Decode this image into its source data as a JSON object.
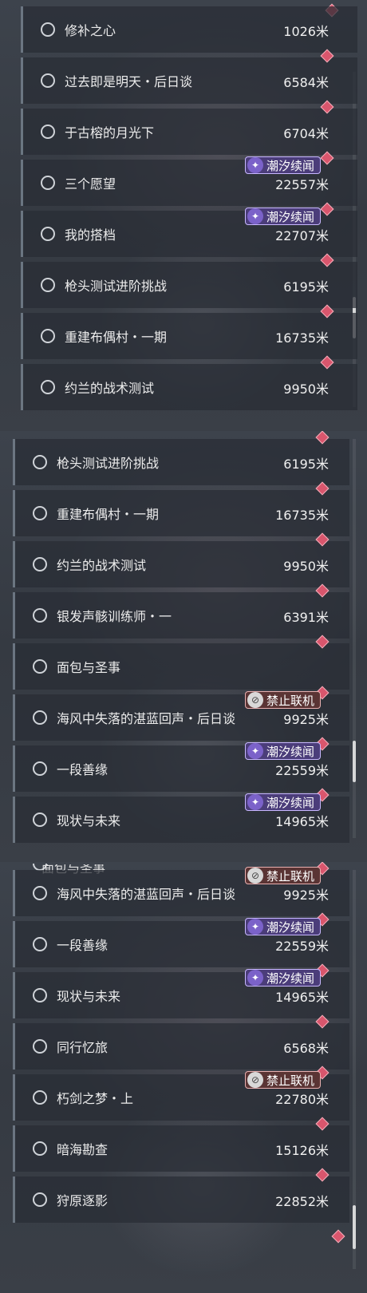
{
  "unit": "米",
  "badges": {
    "tide": {
      "label": "潮汐续闻",
      "icon": "sparkle-icon",
      "color": "#4b3d7a"
    },
    "nolink": {
      "label": "禁止联机",
      "icon": "no-multiplayer-icon",
      "color": "#5a3434"
    }
  },
  "panels": [
    {
      "rows": [
        {
          "title": "修补之心",
          "distance": "1026米",
          "badge": null
        },
        {
          "title": "过去即是明天・后日谈",
          "distance": "6584米",
          "badge": null
        },
        {
          "title": "于古榕的月光下",
          "distance": "6704米",
          "badge": null
        },
        {
          "title": "三个愿望",
          "distance": "22557米",
          "badge": "潮汐续闻"
        },
        {
          "title": "我的搭档",
          "distance": "22707米",
          "badge": "潮汐续闻"
        },
        {
          "title": "枪头测试进阶挑战",
          "distance": "6195米",
          "badge": null
        },
        {
          "title": "重建布偶村・一期",
          "distance": "16735米",
          "badge": null
        },
        {
          "title": "约兰的战术测试",
          "distance": "9950米",
          "badge": null
        }
      ]
    },
    {
      "rows": [
        {
          "title": "枪头测试进阶挑战",
          "distance": "6195米",
          "badge": null
        },
        {
          "title": "重建布偶村・一期",
          "distance": "16735米",
          "badge": null
        },
        {
          "title": "约兰的战术测试",
          "distance": "9950米",
          "badge": null
        },
        {
          "title": "银发声骸训练师・一",
          "distance": "6391米",
          "badge": null
        },
        {
          "title": "面包与圣事",
          "distance": "",
          "badge": null
        },
        {
          "title": "海风中失落的湛蓝回声・后日谈",
          "distance": "9925米",
          "badge": "禁止联机"
        },
        {
          "title": "一段善缘",
          "distance": "22559米",
          "badge": "潮汐续闻"
        },
        {
          "title": "现状与未来",
          "distance": "14965米",
          "badge": "潮汐续闻"
        }
      ]
    },
    {
      "partial_top": "面包与圣事",
      "rows": [
        {
          "title": "海风中失落的湛蓝回声・后日谈",
          "distance": "9925米",
          "badge": "禁止联机"
        },
        {
          "title": "一段善缘",
          "distance": "22559米",
          "badge": "潮汐续闻"
        },
        {
          "title": "现状与未来",
          "distance": "14965米",
          "badge": "潮汐续闻"
        },
        {
          "title": "同行忆旅",
          "distance": "6568米",
          "badge": null
        },
        {
          "title": "朽剑之梦・上",
          "distance": "22780米",
          "badge": "禁止联机"
        },
        {
          "title": "暗海勘查",
          "distance": "15126米",
          "badge": null
        },
        {
          "title": "狩原逐影",
          "distance": "22852米",
          "badge": null
        }
      ]
    }
  ]
}
